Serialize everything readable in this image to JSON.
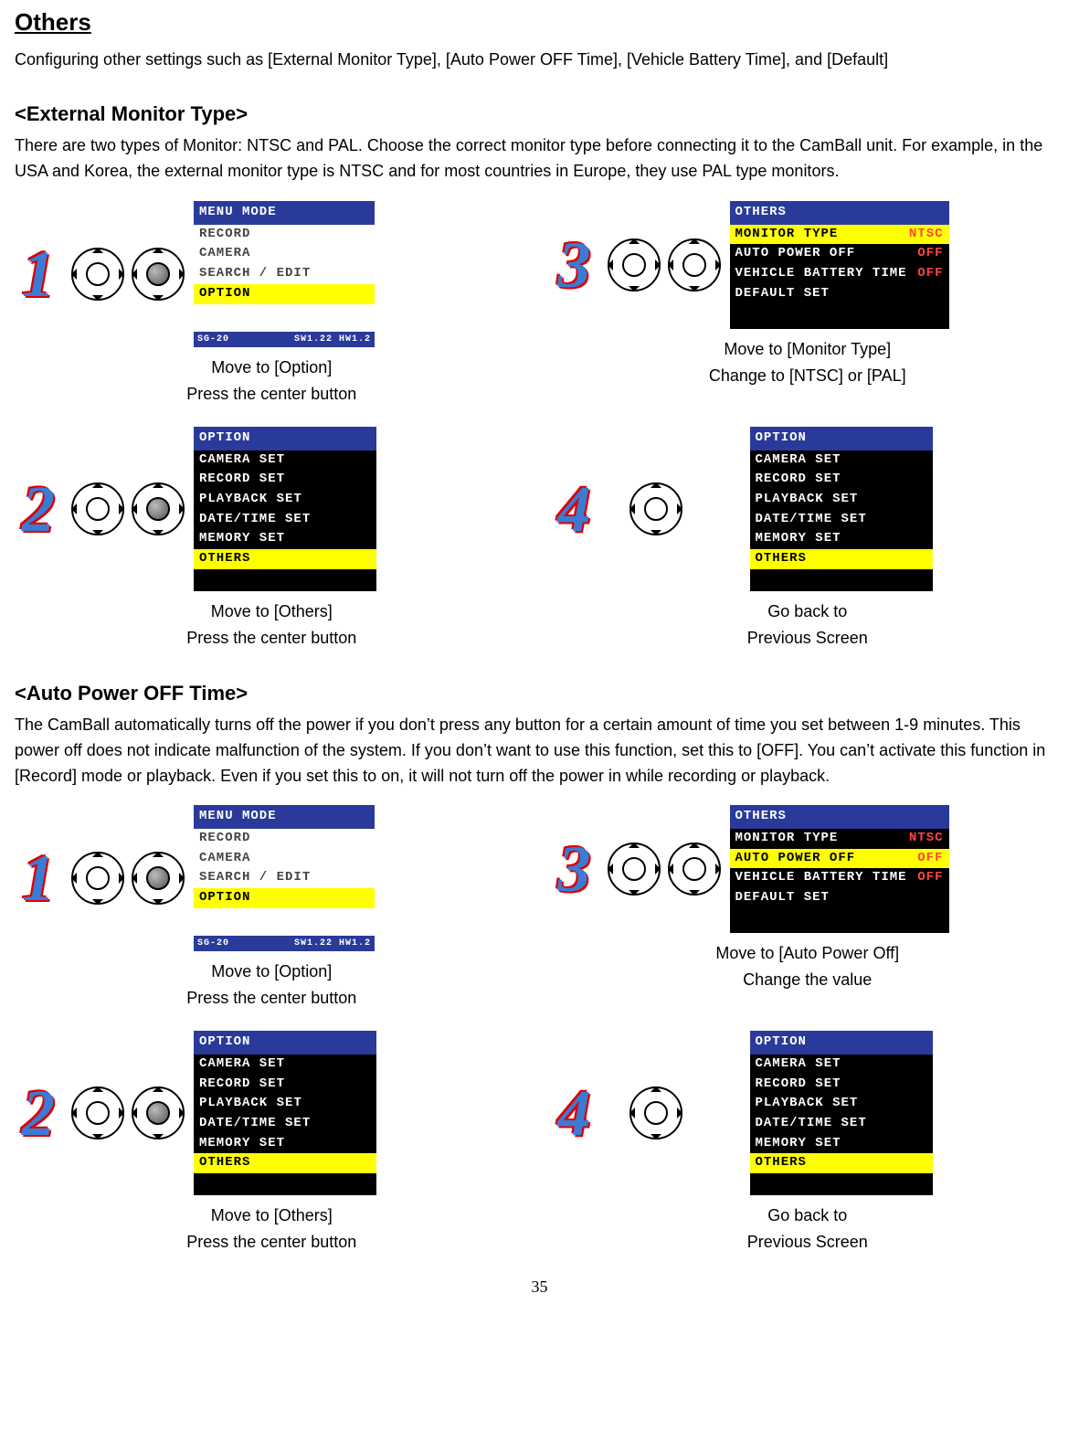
{
  "page_number": "35",
  "title": "Others",
  "intro": "Configuring other settings such as [External Monitor Type], [Auto Power OFF Time], [Vehicle Battery Time], and [Default]",
  "section1": {
    "heading": "<External Monitor Type>",
    "body": " There are two types of Monitor: NTSC and PAL. Choose the correct monitor type before connecting it to the CamBall unit. For example, in the USA and Korea, the external monitor type is NTSC and for most countries in Europe, they use PAL type monitors.",
    "steps": {
      "s1a": "Move to [Option]",
      "s1b": "Press the center button",
      "s2a": "Move to [Others]",
      "s2b": "Press the center button",
      "s3a": "Move to [Monitor Type]",
      "s3b": "Change to [NTSC] or [PAL]",
      "s4a": "Go back to",
      "s4b": "Previous Screen"
    }
  },
  "section2": {
    "heading": "<Auto Power OFF Time>",
    "body": "The CamBall automatically turns off the power if you don’t press any button for a certain amount of time you set between 1-9 minutes. This power off does not indicate malfunction of the system. If you don’t want to use this function, set this to [OFF]. You can’t activate this function in [Record] mode or playback. Even if you set this to on, it will not turn off the power in while recording or playback.",
    "steps": {
      "s1a": "Move to [Option]",
      "s1b": "Press the center button",
      "s2a": "Move to [Others]",
      "s2b": "Press the center button",
      "s3a": "Move to [Auto Power Off]",
      "s3b": "Change the value",
      "s4a": "Go back to",
      "s4b": "Previous Screen"
    }
  },
  "lcd_menu": {
    "header": "MENU MODE",
    "items": [
      "RECORD",
      "CAMERA",
      "SEARCH / EDIT",
      "OPTION"
    ],
    "selected": "OPTION",
    "footer_left": "SG-20",
    "footer_right": "SW1.22 HW1.2"
  },
  "lcd_option": {
    "header": "OPTION",
    "items": [
      "CAMERA SET",
      "RECORD SET",
      "PLAYBACK SET",
      "DATE/TIME SET",
      "MEMORY SET",
      "OTHERS"
    ],
    "selected": "OTHERS"
  },
  "lcd_others_monitor": {
    "header": "OTHERS",
    "rows": [
      {
        "label": "MONITOR TYPE",
        "value": "NTSC",
        "hi": true
      },
      {
        "label": "AUTO POWER OFF",
        "value": "OFF",
        "hi": false
      },
      {
        "label": "VEHICLE BATTERY TIME",
        "value": "OFF",
        "hi": false
      },
      {
        "label": "DEFAULT SET",
        "value": "",
        "hi": false
      }
    ]
  },
  "lcd_others_auto": {
    "header": "OTHERS",
    "rows": [
      {
        "label": "MONITOR TYPE",
        "value": "NTSC",
        "hi": false
      },
      {
        "label": "AUTO POWER OFF",
        "value": "OFF",
        "hi": true
      },
      {
        "label": "VEHICLE BATTERY TIME",
        "value": "OFF",
        "hi": false
      },
      {
        "label": "DEFAULT SET",
        "value": "",
        "hi": false
      }
    ]
  },
  "nums": {
    "n1": "1",
    "n2": "2",
    "n3": "3",
    "n4": "4"
  }
}
